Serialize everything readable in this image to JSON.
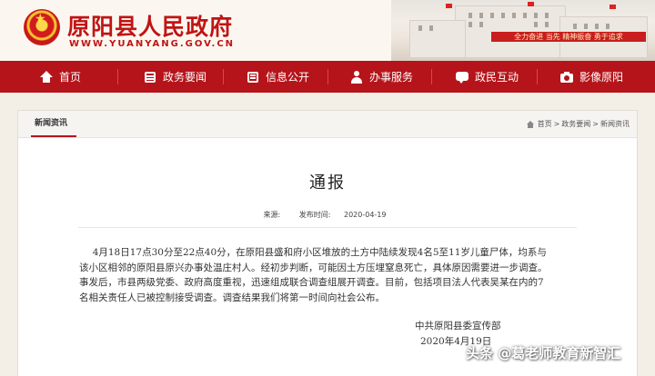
{
  "header": {
    "site_title": "原阳县人民政府",
    "site_url": "WWW.YUANYANG.GOV.CN",
    "banner_text": "全力奋进 当先 精神振奋 勇于追求"
  },
  "nav": {
    "items": [
      {
        "label": "首页",
        "icon": "home-icon"
      },
      {
        "label": "政务要闻",
        "icon": "news-icon"
      },
      {
        "label": "信息公开",
        "icon": "document-icon"
      },
      {
        "label": "办事服务",
        "icon": "person-icon"
      },
      {
        "label": "政民互动",
        "icon": "chat-icon"
      },
      {
        "label": "影像原阳",
        "icon": "camera-icon"
      }
    ]
  },
  "panel": {
    "section_title": "新闻资讯",
    "breadcrumb": {
      "home": "首页",
      "sep": ">",
      "level1": "政务要闻",
      "level2": "新闻资讯"
    }
  },
  "article": {
    "title": "通报",
    "source_label": "来源:",
    "published_label": "发布时间:",
    "published_date": "2020-04-19",
    "paragraph": "4月18日17点30分至22点40分，在原阳县盛和府小区堆放的土方中陆续发现4名5至11岁儿童尸体，均系与该小区相邻的原阳县原兴办事处温庄村人。经初步判断，可能因土方压埋窒息死亡，具体原因需要进一步调查。事发后，市县两级党委、政府高度重视，迅速组成联合调查组展开调查。目前，包括项目法人代表吴某在内的7名相关责任人已被控制接受调查。调查结果我们将第一时间向社会公布。",
    "signature_org": "中共原阳县委宣传部",
    "signature_date": "2020年4月19日"
  },
  "watermark": "头条 @葛老师教育新智汇",
  "colors": {
    "brand_red": "#b5141a",
    "title_red": "#c01414"
  }
}
